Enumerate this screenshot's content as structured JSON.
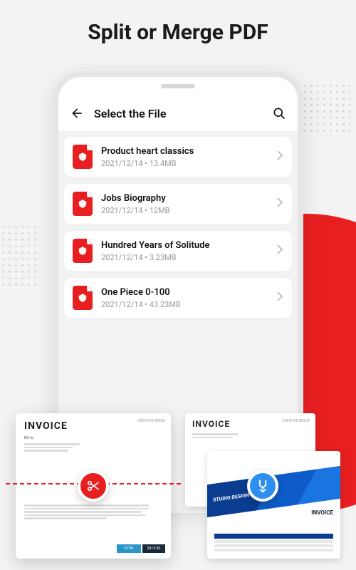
{
  "hero": {
    "title": "Split or Merge PDF"
  },
  "app": {
    "header": {
      "back_label": "Back",
      "title": "Select the File",
      "search_label": "Search"
    },
    "files": [
      {
        "name": "Product heart classics",
        "date": "2021/12/14",
        "size": "13.4MB"
      },
      {
        "name": "Jobs Biography",
        "date": "2021/12/14",
        "size": "12MB"
      },
      {
        "name": "Hundred Years of Solitude",
        "date": "2021/12/14",
        "size": "3.23MB"
      },
      {
        "name": "One Piece 0-100",
        "date": "2021/12/14",
        "size": "43.23MB"
      }
    ]
  },
  "previews": {
    "split": {
      "action_icon": "scissors-icon",
      "invoice_label": "INVOICE",
      "billto": "Bill to:",
      "brand": "CREATIVE MEDIA",
      "total_label": "TOTAL",
      "total_value": "$415.00"
    },
    "merge": {
      "action_icon": "merge-icon",
      "invoice_label": "INVOICE",
      "brand": "CREATIVE MEDIA",
      "studio": "STUDIO DESIGN"
    }
  },
  "colors": {
    "accent_red": "#e71f21",
    "accent_blue": "#2d8df1"
  }
}
